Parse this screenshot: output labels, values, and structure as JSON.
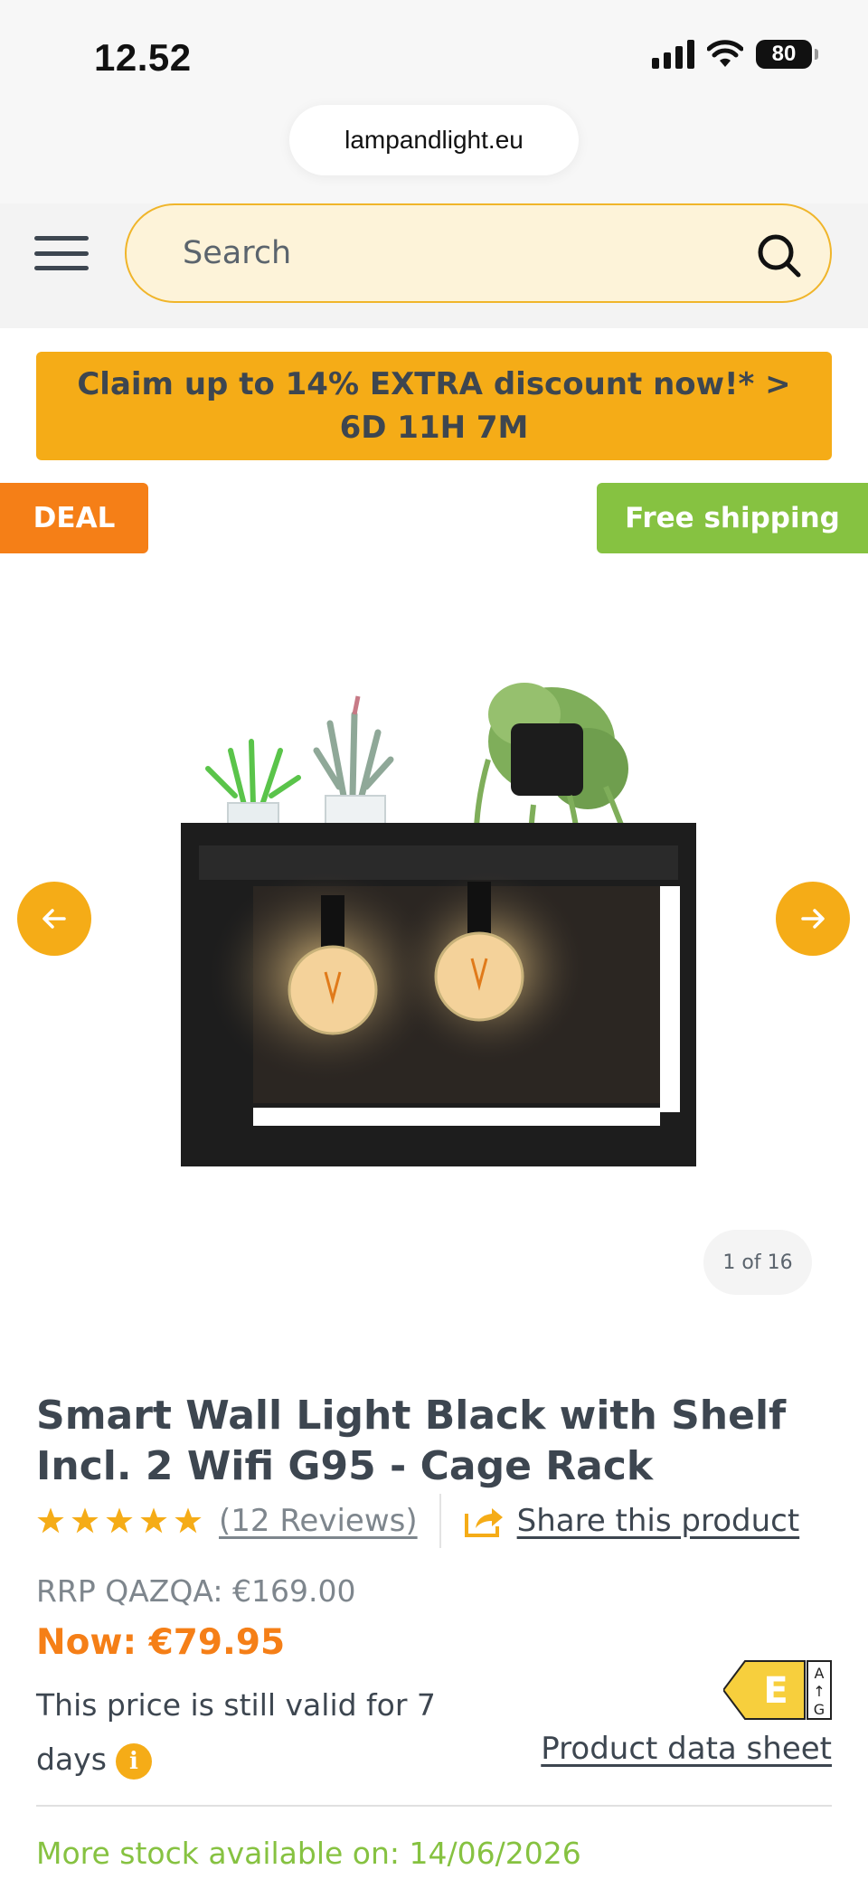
{
  "status_bar": {
    "time": "12.52",
    "battery": "80"
  },
  "browser": {
    "url": "lampandlight.eu"
  },
  "header": {
    "search_placeholder": "Search"
  },
  "promo": {
    "line1": "Claim up to 14% EXTRA discount now!* >",
    "line2": "6D 11H 7M"
  },
  "badges": {
    "deal": "DEAL",
    "shipping": "Free shipping"
  },
  "gallery": {
    "counter": "1 of 16"
  },
  "product": {
    "title": "Smart Wall Light Black with Shelf Incl. 2 Wifi G95 - Cage Rack",
    "rating": 5,
    "reviews": "(12 Reviews)",
    "share": "Share this product",
    "rrp": "RRP QAZQA: €169.00",
    "now": "Now: €79.95",
    "validity": "This price is still valid for 7 days",
    "energy_class": "E",
    "energy_scale": [
      "A",
      "↑",
      "G"
    ],
    "datasheet": "Product data sheet",
    "stock": "More stock available on: 14/06/2026"
  },
  "colors": {
    "accent": "#f5ac17",
    "deal": "#f57f17",
    "shipping": "#86c241",
    "text": "#3d4650"
  }
}
